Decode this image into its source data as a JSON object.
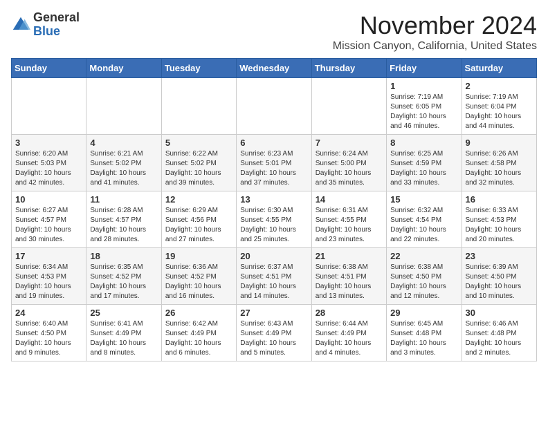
{
  "header": {
    "logo_general": "General",
    "logo_blue": "Blue",
    "month_title": "November 2024",
    "location": "Mission Canyon, California, United States"
  },
  "days_of_week": [
    "Sunday",
    "Monday",
    "Tuesday",
    "Wednesday",
    "Thursday",
    "Friday",
    "Saturday"
  ],
  "weeks": [
    [
      {
        "day": "",
        "content": ""
      },
      {
        "day": "",
        "content": ""
      },
      {
        "day": "",
        "content": ""
      },
      {
        "day": "",
        "content": ""
      },
      {
        "day": "",
        "content": ""
      },
      {
        "day": "1",
        "content": "Sunrise: 7:19 AM\nSunset: 6:05 PM\nDaylight: 10 hours and 46 minutes."
      },
      {
        "day": "2",
        "content": "Sunrise: 7:19 AM\nSunset: 6:04 PM\nDaylight: 10 hours and 44 minutes."
      }
    ],
    [
      {
        "day": "3",
        "content": "Sunrise: 6:20 AM\nSunset: 5:03 PM\nDaylight: 10 hours and 42 minutes."
      },
      {
        "day": "4",
        "content": "Sunrise: 6:21 AM\nSunset: 5:02 PM\nDaylight: 10 hours and 41 minutes."
      },
      {
        "day": "5",
        "content": "Sunrise: 6:22 AM\nSunset: 5:02 PM\nDaylight: 10 hours and 39 minutes."
      },
      {
        "day": "6",
        "content": "Sunrise: 6:23 AM\nSunset: 5:01 PM\nDaylight: 10 hours and 37 minutes."
      },
      {
        "day": "7",
        "content": "Sunrise: 6:24 AM\nSunset: 5:00 PM\nDaylight: 10 hours and 35 minutes."
      },
      {
        "day": "8",
        "content": "Sunrise: 6:25 AM\nSunset: 4:59 PM\nDaylight: 10 hours and 33 minutes."
      },
      {
        "day": "9",
        "content": "Sunrise: 6:26 AM\nSunset: 4:58 PM\nDaylight: 10 hours and 32 minutes."
      }
    ],
    [
      {
        "day": "10",
        "content": "Sunrise: 6:27 AM\nSunset: 4:57 PM\nDaylight: 10 hours and 30 minutes."
      },
      {
        "day": "11",
        "content": "Sunrise: 6:28 AM\nSunset: 4:57 PM\nDaylight: 10 hours and 28 minutes."
      },
      {
        "day": "12",
        "content": "Sunrise: 6:29 AM\nSunset: 4:56 PM\nDaylight: 10 hours and 27 minutes."
      },
      {
        "day": "13",
        "content": "Sunrise: 6:30 AM\nSunset: 4:55 PM\nDaylight: 10 hours and 25 minutes."
      },
      {
        "day": "14",
        "content": "Sunrise: 6:31 AM\nSunset: 4:55 PM\nDaylight: 10 hours and 23 minutes."
      },
      {
        "day": "15",
        "content": "Sunrise: 6:32 AM\nSunset: 4:54 PM\nDaylight: 10 hours and 22 minutes."
      },
      {
        "day": "16",
        "content": "Sunrise: 6:33 AM\nSunset: 4:53 PM\nDaylight: 10 hours and 20 minutes."
      }
    ],
    [
      {
        "day": "17",
        "content": "Sunrise: 6:34 AM\nSunset: 4:53 PM\nDaylight: 10 hours and 19 minutes."
      },
      {
        "day": "18",
        "content": "Sunrise: 6:35 AM\nSunset: 4:52 PM\nDaylight: 10 hours and 17 minutes."
      },
      {
        "day": "19",
        "content": "Sunrise: 6:36 AM\nSunset: 4:52 PM\nDaylight: 10 hours and 16 minutes."
      },
      {
        "day": "20",
        "content": "Sunrise: 6:37 AM\nSunset: 4:51 PM\nDaylight: 10 hours and 14 minutes."
      },
      {
        "day": "21",
        "content": "Sunrise: 6:38 AM\nSunset: 4:51 PM\nDaylight: 10 hours and 13 minutes."
      },
      {
        "day": "22",
        "content": "Sunrise: 6:38 AM\nSunset: 4:50 PM\nDaylight: 10 hours and 12 minutes."
      },
      {
        "day": "23",
        "content": "Sunrise: 6:39 AM\nSunset: 4:50 PM\nDaylight: 10 hours and 10 minutes."
      }
    ],
    [
      {
        "day": "24",
        "content": "Sunrise: 6:40 AM\nSunset: 4:50 PM\nDaylight: 10 hours and 9 minutes."
      },
      {
        "day": "25",
        "content": "Sunrise: 6:41 AM\nSunset: 4:49 PM\nDaylight: 10 hours and 8 minutes."
      },
      {
        "day": "26",
        "content": "Sunrise: 6:42 AM\nSunset: 4:49 PM\nDaylight: 10 hours and 6 minutes."
      },
      {
        "day": "27",
        "content": "Sunrise: 6:43 AM\nSunset: 4:49 PM\nDaylight: 10 hours and 5 minutes."
      },
      {
        "day": "28",
        "content": "Sunrise: 6:44 AM\nSunset: 4:49 PM\nDaylight: 10 hours and 4 minutes."
      },
      {
        "day": "29",
        "content": "Sunrise: 6:45 AM\nSunset: 4:48 PM\nDaylight: 10 hours and 3 minutes."
      },
      {
        "day": "30",
        "content": "Sunrise: 6:46 AM\nSunset: 4:48 PM\nDaylight: 10 hours and 2 minutes."
      }
    ]
  ]
}
